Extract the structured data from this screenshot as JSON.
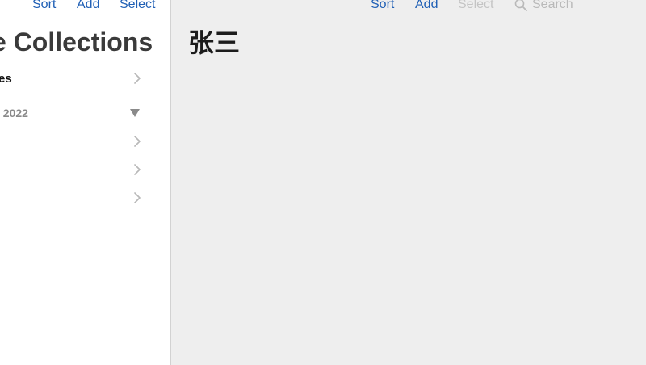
{
  "sidebar": {
    "toolbar": {
      "sort_label": "Sort",
      "add_label": "Add",
      "select_label": "Select"
    },
    "title": "e Collections",
    "items": [
      {
        "label": "es"
      }
    ],
    "section": {
      "label": "/ 2022",
      "items": [
        {
          "label": ""
        },
        {
          "label": ""
        },
        {
          "label": ""
        }
      ]
    }
  },
  "detail": {
    "toolbar": {
      "sort_label": "Sort",
      "add_label": "Add",
      "select_label": "Select",
      "search_placeholder": "Search"
    },
    "title": "张三"
  },
  "colors": {
    "accent": "#1f5fb5",
    "disabled": "#c4c4c4",
    "sidebar_bg": "#ffffff",
    "content_bg": "#eeeeee"
  },
  "icons": {
    "row_disclosure": "chevron-right-icon",
    "section_toggle": "triangle-down-icon",
    "search": "magnifying-glass-icon"
  }
}
